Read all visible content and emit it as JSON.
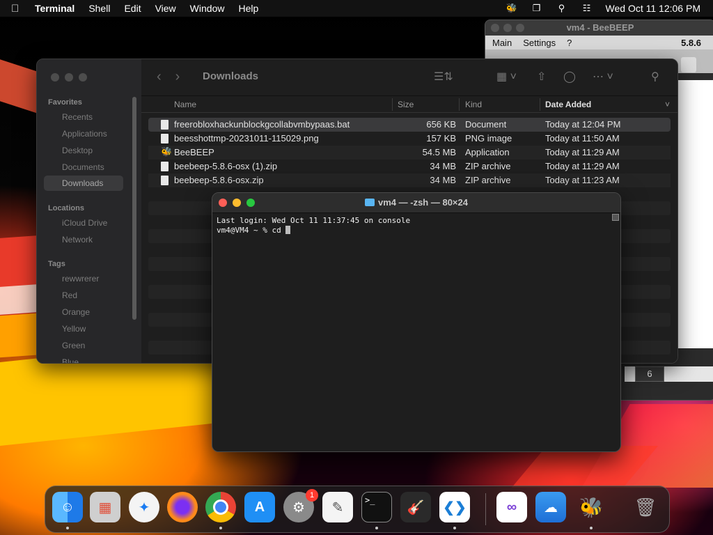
{
  "menubar": {
    "app": "Terminal",
    "items": [
      "Shell",
      "Edit",
      "View",
      "Window",
      "Help"
    ],
    "clock": "Wed Oct 11  12:06 PM"
  },
  "beebeep": {
    "title": "vm4 - BeeBEEP",
    "menu": [
      "Main",
      "Settings",
      "?"
    ],
    "version": "5.8.6",
    "badge_count": "6"
  },
  "finder": {
    "title": "Downloads",
    "sidebar": {
      "favorites_label": "Favorites",
      "favorites": [
        "Recents",
        "Applications",
        "Desktop",
        "Documents",
        "Downloads"
      ],
      "locations_label": "Locations",
      "locations": [
        "iCloud Drive",
        "Network"
      ],
      "tags_label": "Tags",
      "tags": [
        "rewwrerer",
        "Red",
        "Orange",
        "Yellow",
        "Green",
        "Blue"
      ]
    },
    "columns": {
      "name": "Name",
      "size": "Size",
      "kind": "Kind",
      "date": "Date Added"
    },
    "files": [
      {
        "name": "freerobloxhackunblockgcollabvmbypaas.bat",
        "size": "656 KB",
        "kind": "Document",
        "date": "Today at 12:04 PM"
      },
      {
        "name": "beesshottmp-20231011-115029.png",
        "size": "157 KB",
        "kind": "PNG image",
        "date": "Today at 11:50 AM"
      },
      {
        "name": "BeeBEEP",
        "size": "54.5 MB",
        "kind": "Application",
        "date": "Today at 11:29 AM"
      },
      {
        "name": "beebeep-5.8.6-osx (1).zip",
        "size": "34 MB",
        "kind": "ZIP archive",
        "date": "Today at 11:29 AM"
      },
      {
        "name": "beebeep-5.8.6-osx.zip",
        "size": "34 MB",
        "kind": "ZIP archive",
        "date": "Today at 11:23 AM"
      }
    ]
  },
  "terminal": {
    "title": "vm4 — -zsh — 80×24",
    "line1": "Last login: Wed Oct 11 11:37:45 on console",
    "prompt": "vm4@VM4 ~ % cd "
  },
  "dock": {
    "settings_badge": "1",
    "colors": {
      "finder": "#1e8cf0",
      "launchpad": "#d0d0d0",
      "safari": "#1a7cf2",
      "firefox": "#ff6a1a",
      "chrome": "#ffffff",
      "appstore": "#1f8ff5",
      "settings": "#8a8a8a",
      "textedit": "#f4f4f4",
      "terminal": "#111111",
      "garageband": "#222222",
      "vscode": "#ffffff",
      "vs": "#ffffff",
      "weather": "#2d88e6",
      "beebeep": "#f0c020",
      "trash": "#a8a8a8"
    }
  }
}
